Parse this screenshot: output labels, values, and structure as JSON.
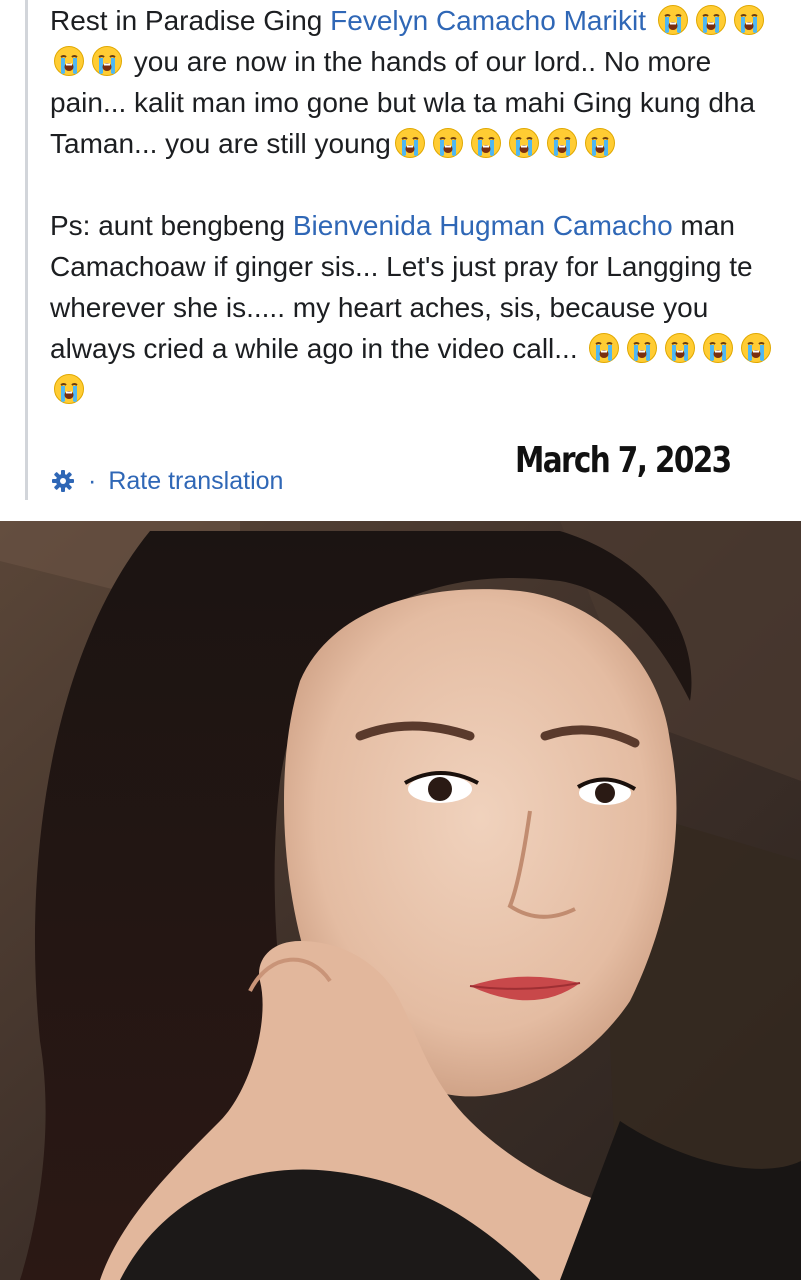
{
  "post": {
    "para1": {
      "text1": "Rest in Paradise Ging ",
      "mention": "Fevelyn Camacho Marikit",
      "text2": " you are now in the hands of our lord.. No more pain... kalit man imo gone but wla ta mahi Ging kung dha Taman... you are still young"
    },
    "para2": {
      "text1": "Ps: aunt bengbeng ",
      "mention": "Bienvenida Hugman Camacho",
      "text2": " man Camachoaw if ginger sis... Let's just pray for Langging te wherever she is..... my heart aches, sis, because you always cried a while ago in the video call..."
    },
    "emoji_icon": "loudly-crying-face-emoji"
  },
  "translation": {
    "icon": "gear-icon",
    "separator": "·",
    "label": "Rate translation"
  },
  "overlay": {
    "date": "March 7, 2023"
  },
  "photo": {
    "subject": "portrait-photo"
  },
  "colors": {
    "link": "#2f67b6",
    "text": "#1c1e21",
    "quote_bar": "#d2d5da"
  }
}
